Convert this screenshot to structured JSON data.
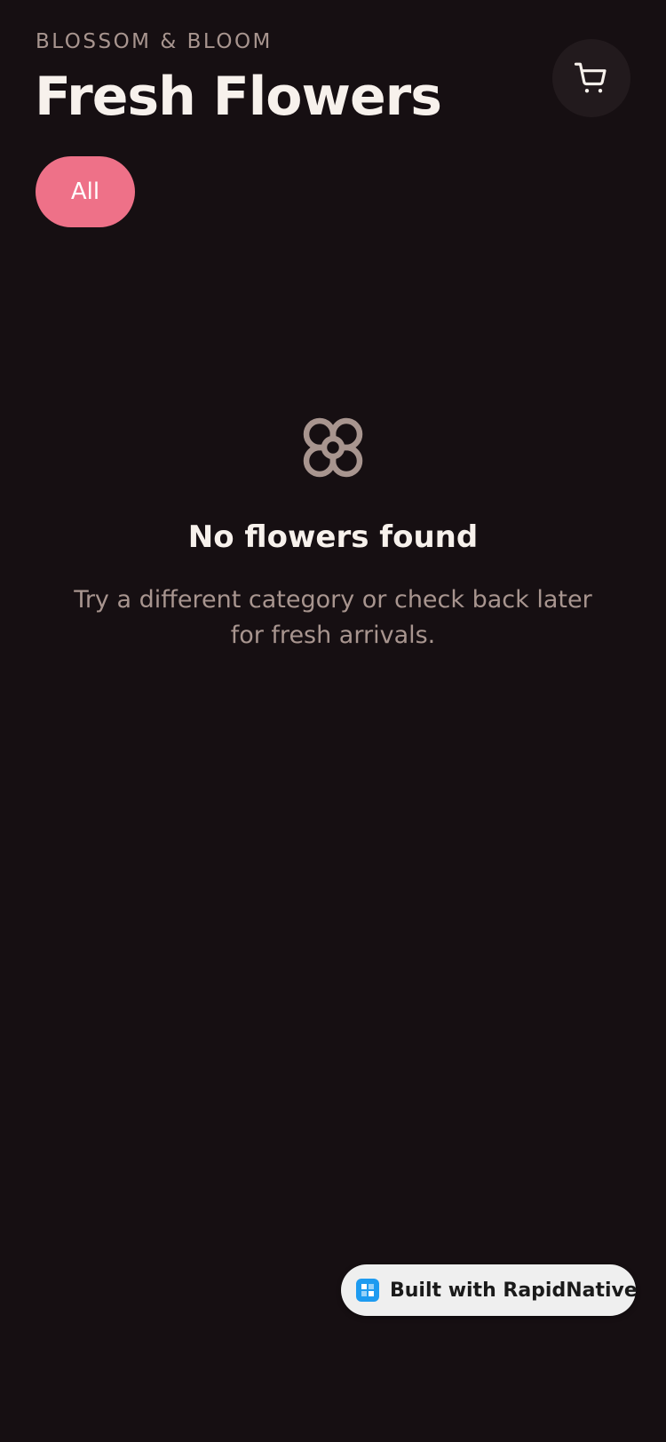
{
  "header": {
    "brand": "BLOSSOM & BLOOM",
    "title": "Fresh Flowers",
    "cart_icon": "cart-icon"
  },
  "filters": {
    "chips": [
      {
        "label": "All",
        "selected": true
      }
    ]
  },
  "empty_state": {
    "icon": "flower-icon",
    "title": "No flowers found",
    "description": "Try a different category or check back later for fresh arrivals."
  },
  "footer_badge": {
    "label": "Built with RapidNative",
    "icon": "rapidnative-logo-icon"
  },
  "colors": {
    "background": "#160F12",
    "accent": "#EE7188",
    "muted_text": "#A8958F",
    "primary_text": "#F7F1EC",
    "cart_button_bg": "#221A1D",
    "badge_bg": "#EFEFEF",
    "badge_logo": "#1E9BF0"
  }
}
